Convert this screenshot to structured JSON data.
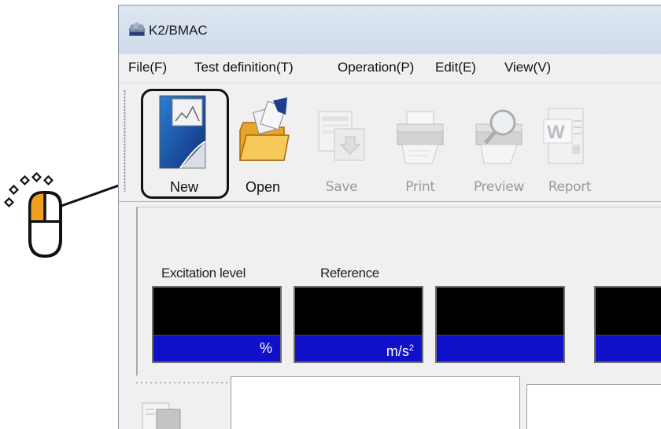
{
  "window": {
    "title": "K2/BMAC"
  },
  "menu": [
    {
      "label": "File(F)"
    },
    {
      "label": "Test definition(T)"
    },
    {
      "label": "Operation(P)"
    },
    {
      "label": "Edit(E)"
    },
    {
      "label": "View(V)"
    }
  ],
  "toolbar": [
    {
      "label": "New",
      "icon": "new-document-icon",
      "enabled": true,
      "highlighted": true
    },
    {
      "label": "Open",
      "icon": "open-folder-icon",
      "enabled": true
    },
    {
      "label": "Save",
      "icon": "save-icon",
      "enabled": false
    },
    {
      "label": "Print",
      "icon": "printer-icon",
      "enabled": false
    },
    {
      "label": "Preview",
      "icon": "print-preview-icon",
      "enabled": false
    },
    {
      "label": "Report",
      "icon": "word-report-icon",
      "enabled": false
    }
  ],
  "meters": {
    "excitation": {
      "label": "Excitation level",
      "unit": "%"
    },
    "reference": {
      "label": "Reference",
      "unit_base": "m/s",
      "unit_sup": "2"
    }
  },
  "annotation": {
    "icon": "mouse-left-click-icon",
    "highlight_color": "#f0a020"
  }
}
